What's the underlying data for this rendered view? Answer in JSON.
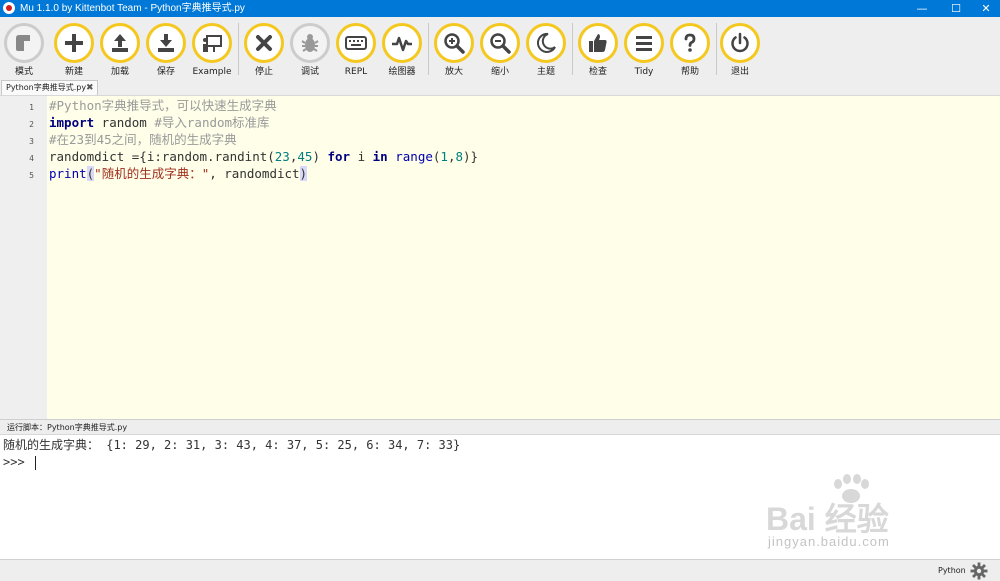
{
  "window": {
    "title": "Mu 1.1.0 by Kittenbot Team - Python字典推导式.py",
    "minimize": "—",
    "maximize": "☐",
    "close": "✕"
  },
  "toolbar": {
    "buttons": [
      {
        "label": "模式",
        "icon": "mode-icon"
      },
      {
        "label": "新建",
        "icon": "plus-icon"
      },
      {
        "label": "加载",
        "icon": "upload-icon"
      },
      {
        "label": "保存",
        "icon": "download-icon"
      },
      {
        "label": "Example",
        "icon": "presentation-icon"
      },
      {
        "label": "停止",
        "icon": "x-icon"
      },
      {
        "label": "调试",
        "icon": "bug-icon"
      },
      {
        "label": "REPL",
        "icon": "keyboard-icon"
      },
      {
        "label": "绘图器",
        "icon": "pulse-icon"
      },
      {
        "label": "放大",
        "icon": "zoom-in-icon"
      },
      {
        "label": "缩小",
        "icon": "zoom-out-icon"
      },
      {
        "label": "主题",
        "icon": "moon-icon"
      },
      {
        "label": "检查",
        "icon": "thumbs-up-icon"
      },
      {
        "label": "Tidy",
        "icon": "lines-icon"
      },
      {
        "label": "帮助",
        "icon": "question-icon"
      },
      {
        "label": "退出",
        "icon": "power-icon"
      }
    ],
    "accent_color": "#f4c81e"
  },
  "tab": {
    "label": "Python字典推导式.py",
    "close": "✖"
  },
  "editor": {
    "line_numbers": [
      "1",
      "2",
      "3",
      "4",
      "5"
    ],
    "lines": [
      {
        "comment": "#Python字典推导式，可以快速生成字典"
      },
      {
        "kw": "import",
        "rest": " random ",
        "comment": "#导入random标准库"
      },
      {
        "comment": "#在23到45之间，随机的生成字典"
      },
      {
        "a": "randomdict ={i:random.randint(",
        "n1": "23",
        "b": ",",
        "n2": "45",
        "c": ") ",
        "kw1": "for",
        "d": " i ",
        "kw2": "in",
        "e": " ",
        "bi": "range",
        "f": "(",
        "n3": "1",
        "g": ",",
        "n4": "8",
        "h": ")}"
      },
      {
        "bi": "print",
        "p1": "(",
        "str": "\"随机的生成字典：\"",
        "rest": ", randomdict",
        "p2": ")"
      }
    ]
  },
  "output_pane": {
    "header": "运行脚本：Python字典推导式.py",
    "result": "随机的生成字典： {1: 29, 2: 31, 3: 43, 4: 37, 5: 25, 6: 34, 7: 33}",
    "prompt": ">>> "
  },
  "watermark": {
    "text": "Bai  经验",
    "sub": "jingyan.baidu.com"
  },
  "statusbar": {
    "mode": "Python",
    "icon": "gear-icon"
  }
}
